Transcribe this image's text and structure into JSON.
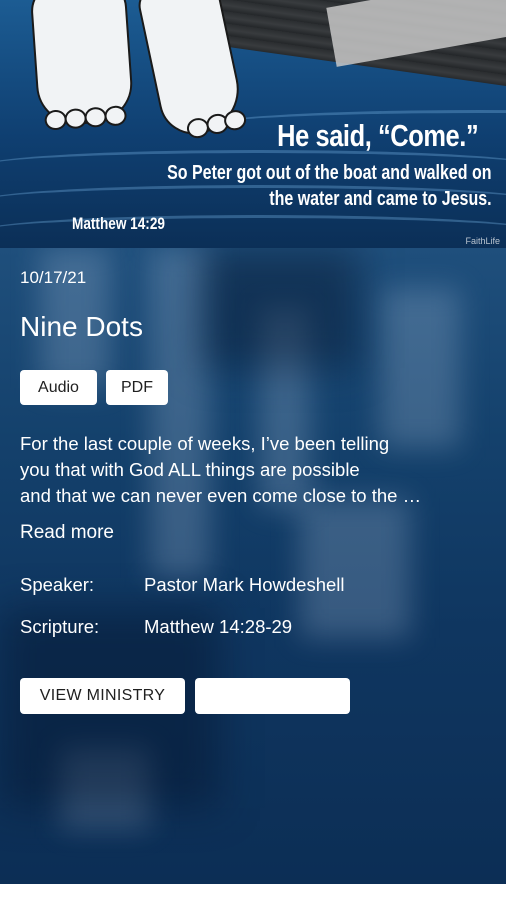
{
  "banner": {
    "quote": "He said, “Come.”",
    "verse_lines": [
      "So Peter got out of the boat and walked on",
      "the water and came to Jesus."
    ],
    "reference": "Matthew 14:29",
    "brand": "FaithLife"
  },
  "sermon": {
    "date": "10/17/21",
    "title": "Nine Dots",
    "media": {
      "audio_label": "Audio",
      "pdf_label": "PDF"
    },
    "description_lines": [
      "For the last couple of weeks, I’ve been telling",
      "you that with God ALL things are possible",
      "and that we can never even come close to the …"
    ],
    "read_more_label": "Read more",
    "speaker_label": "Speaker:",
    "speaker_value": "Pastor Mark Howdeshell",
    "scripture_label": "Scripture:",
    "scripture_value": "Matthew 14:28-29"
  },
  "actions": {
    "view_ministry_label": "VIEW MINISTRY",
    "second_button_label": ""
  },
  "colors": {
    "panel_background": "#14416c",
    "button_background": "#ffffff",
    "text": "#ffffff"
  }
}
